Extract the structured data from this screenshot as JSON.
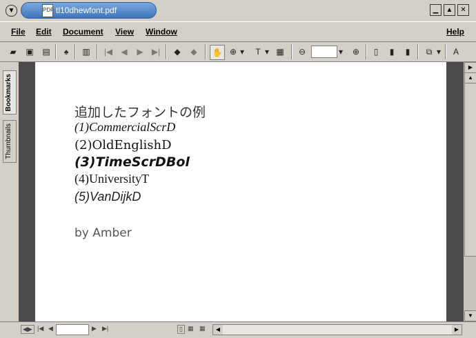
{
  "window": {
    "title": "tl10dhewfont.pdf"
  },
  "menu": {
    "file": "File",
    "edit": "Edit",
    "document": "Document",
    "view": "View",
    "window": "Window",
    "help": "Help"
  },
  "sidebar": {
    "bookmarks": "Bookmarks",
    "thumbnails": "Thumbnails"
  },
  "document": {
    "lines": [
      "追加したフォントの例",
      "(1)CommercialScrD",
      "(2)OldEnglishD",
      "(3)TimeScrDBol",
      "(4)UniversityT",
      "(5)VanDijkD",
      "by  Amber"
    ]
  },
  "zoom": {
    "value": ""
  },
  "status": {
    "page": ""
  },
  "icons": {
    "menu": "menu-icon",
    "pdf": "pdf-file-icon",
    "minimize": "minimize-icon",
    "maximize": "maximize-icon",
    "close": "close-icon"
  }
}
